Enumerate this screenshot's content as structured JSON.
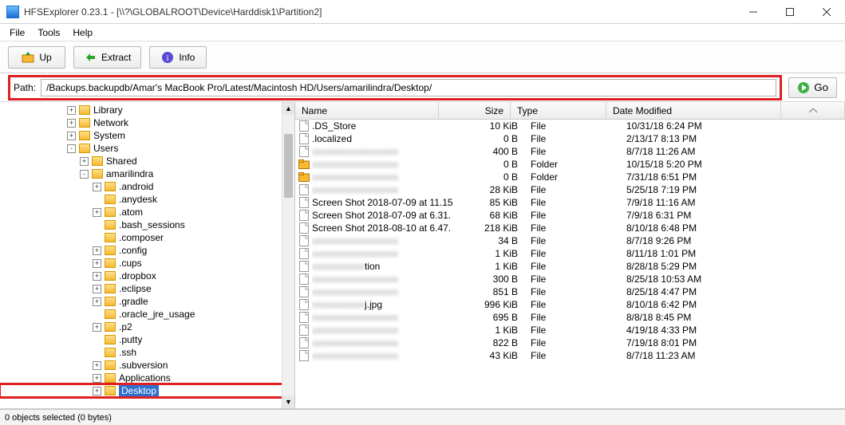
{
  "window": {
    "title": "HFSExplorer 0.23.1 - [\\\\?\\GLOBALROOT\\Device\\Harddisk1\\Partition2]"
  },
  "menu": {
    "file": "File",
    "tools": "Tools",
    "help": "Help"
  },
  "toolbar": {
    "up": "Up",
    "extract": "Extract",
    "info": "Info"
  },
  "pathbar": {
    "label": "Path:",
    "value": "/Backups.backupdb/Amar's MacBook Pro/Latest/Macintosh HD/Users/amarilindra/Desktop/",
    "go": "Go"
  },
  "columns": {
    "name": "Name",
    "size": "Size",
    "type": "Type",
    "date": "Date Modified"
  },
  "tree": {
    "nodes": [
      {
        "indent": 5,
        "exp": "+",
        "label": "Library"
      },
      {
        "indent": 5,
        "exp": "+",
        "label": "Network"
      },
      {
        "indent": 5,
        "exp": "+",
        "label": "System"
      },
      {
        "indent": 5,
        "exp": "-",
        "label": "Users"
      },
      {
        "indent": 6,
        "exp": "+",
        "label": "Shared"
      },
      {
        "indent": 6,
        "exp": "-",
        "label": "amarilindra"
      },
      {
        "indent": 7,
        "exp": "+",
        "label": ".android"
      },
      {
        "indent": 7,
        "exp": "",
        "label": ".anydesk"
      },
      {
        "indent": 7,
        "exp": "+",
        "label": ".atom"
      },
      {
        "indent": 7,
        "exp": "",
        "label": ".bash_sessions"
      },
      {
        "indent": 7,
        "exp": "",
        "label": ".composer"
      },
      {
        "indent": 7,
        "exp": "+",
        "label": ".config"
      },
      {
        "indent": 7,
        "exp": "+",
        "label": ".cups"
      },
      {
        "indent": 7,
        "exp": "+",
        "label": ".dropbox"
      },
      {
        "indent": 7,
        "exp": "+",
        "label": ".eclipse"
      },
      {
        "indent": 7,
        "exp": "+",
        "label": ".gradle"
      },
      {
        "indent": 7,
        "exp": "",
        "label": ".oracle_jre_usage"
      },
      {
        "indent": 7,
        "exp": "+",
        "label": ".p2"
      },
      {
        "indent": 7,
        "exp": "",
        "label": ".putty"
      },
      {
        "indent": 7,
        "exp": "",
        "label": ".ssh"
      },
      {
        "indent": 7,
        "exp": "+",
        "label": ".subversion"
      },
      {
        "indent": 7,
        "exp": "+",
        "label": "Applications"
      },
      {
        "indent": 7,
        "exp": "+",
        "label": "Desktop",
        "selected": true,
        "annot": true
      }
    ]
  },
  "files": [
    {
      "name": ".DS_Store",
      "size": "10 KiB",
      "type": "File",
      "date": "10/31/18 6:24 PM",
      "icon": "file"
    },
    {
      "name": ".localized",
      "size": "0 B",
      "type": "File",
      "date": "2/13/17 8:13 PM",
      "icon": "file"
    },
    {
      "name": "",
      "blur": true,
      "size": "400 B",
      "type": "File",
      "date": "8/7/18 11:26 AM",
      "icon": "file"
    },
    {
      "name": "",
      "blur": true,
      "size": "0 B",
      "type": "Folder",
      "date": "10/15/18 5:20 PM",
      "icon": "folder"
    },
    {
      "name": "",
      "blur": true,
      "size": "0 B",
      "type": "Folder",
      "date": "7/31/18 6:51 PM",
      "icon": "folder"
    },
    {
      "name": "",
      "blur": true,
      "size": "28 KiB",
      "type": "File",
      "date": "5/25/18 7:19 PM",
      "icon": "file"
    },
    {
      "name": "Screen Shot 2018-07-09 at 11.15",
      "size": "85 KiB",
      "type": "File",
      "date": "7/9/18 11:16 AM",
      "icon": "file"
    },
    {
      "name": "Screen Shot 2018-07-09 at 6.31.",
      "size": "68 KiB",
      "type": "File",
      "date": "7/9/18 6:31 PM",
      "icon": "file"
    },
    {
      "name": "Screen Shot 2018-08-10 at 6.47.",
      "size": "218 KiB",
      "type": "File",
      "date": "8/10/18 6:48 PM",
      "icon": "file"
    },
    {
      "name": "",
      "blur": true,
      "size": "34 B",
      "type": "File",
      "date": "8/7/18 9:26 PM",
      "icon": "file"
    },
    {
      "name": "",
      "blur": true,
      "size": "1 KiB",
      "type": "File",
      "date": "8/11/18 1:01 PM",
      "icon": "file"
    },
    {
      "name": "tion",
      "blur": true,
      "suffix": "tion",
      "size": "1 KiB",
      "type": "File",
      "date": "8/28/18 5:29 PM",
      "icon": "file"
    },
    {
      "name": "",
      "blur": true,
      "size": "300 B",
      "type": "File",
      "date": "8/25/18 10:53 AM",
      "icon": "file"
    },
    {
      "name": "",
      "blur": true,
      "size": "851 B",
      "type": "File",
      "date": "8/25/18 4:47 PM",
      "icon": "file"
    },
    {
      "name": "j.jpg",
      "blur": true,
      "suffix": "j.jpg",
      "size": "996 KiB",
      "type": "File",
      "date": "8/10/18 6:42 PM",
      "icon": "file"
    },
    {
      "name": "",
      "blur": true,
      "size": "695 B",
      "type": "File",
      "date": "8/8/18 8:45 PM",
      "icon": "file"
    },
    {
      "name": "",
      "blur": true,
      "size": "1 KiB",
      "type": "File",
      "date": "4/19/18 4:33 PM",
      "icon": "file"
    },
    {
      "name": "",
      "blur": true,
      "size": "822 B",
      "type": "File",
      "date": "7/19/18 8:01 PM",
      "icon": "file"
    },
    {
      "name": "",
      "blur": true,
      "size": "43 KiB",
      "type": "File",
      "date": "8/7/18 11:23 AM",
      "icon": "file"
    }
  ],
  "status": "0 objects selected (0 bytes)"
}
